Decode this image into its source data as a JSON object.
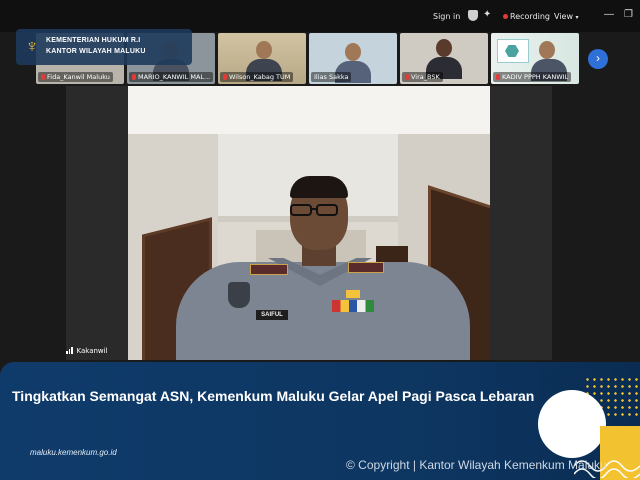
{
  "app_bar": {
    "sign_in": "Sign in",
    "recording": "Recording",
    "view": "View",
    "minimize": "—",
    "restore": "❐"
  },
  "brand": {
    "line1": "KEMENTERIAN HUKUM R.I",
    "line2": "KANTOR WILAYAH MALUKU"
  },
  "participants": [
    {
      "name": "Fida_Kanwil Maluku"
    },
    {
      "name": "MARIO_KANWIL MAL..."
    },
    {
      "name": "Wilson_Kabag TUM"
    },
    {
      "name": "Ilias Sakka"
    },
    {
      "name": "Vira_BSK"
    },
    {
      "name": "KADIV PPPH KANWIL"
    }
  ],
  "speaker": {
    "label": "Kakanwil",
    "nameplate": "SAIFUL"
  },
  "banner": {
    "title": "Tingkatkan Semangat ASN, Kemenkum Maluku Gelar Apel Pagi Pasca Lebaran",
    "url": "maluku.kemenkum.go.id",
    "copyright": "© Copyright | Kantor Wilayah Kemenkum Maluku"
  },
  "colors": {
    "banner_blue": "#0f3b6b",
    "accent_yellow": "#f2c230",
    "recording_red": "#e53935",
    "next_button_blue": "#2f6fd8"
  }
}
